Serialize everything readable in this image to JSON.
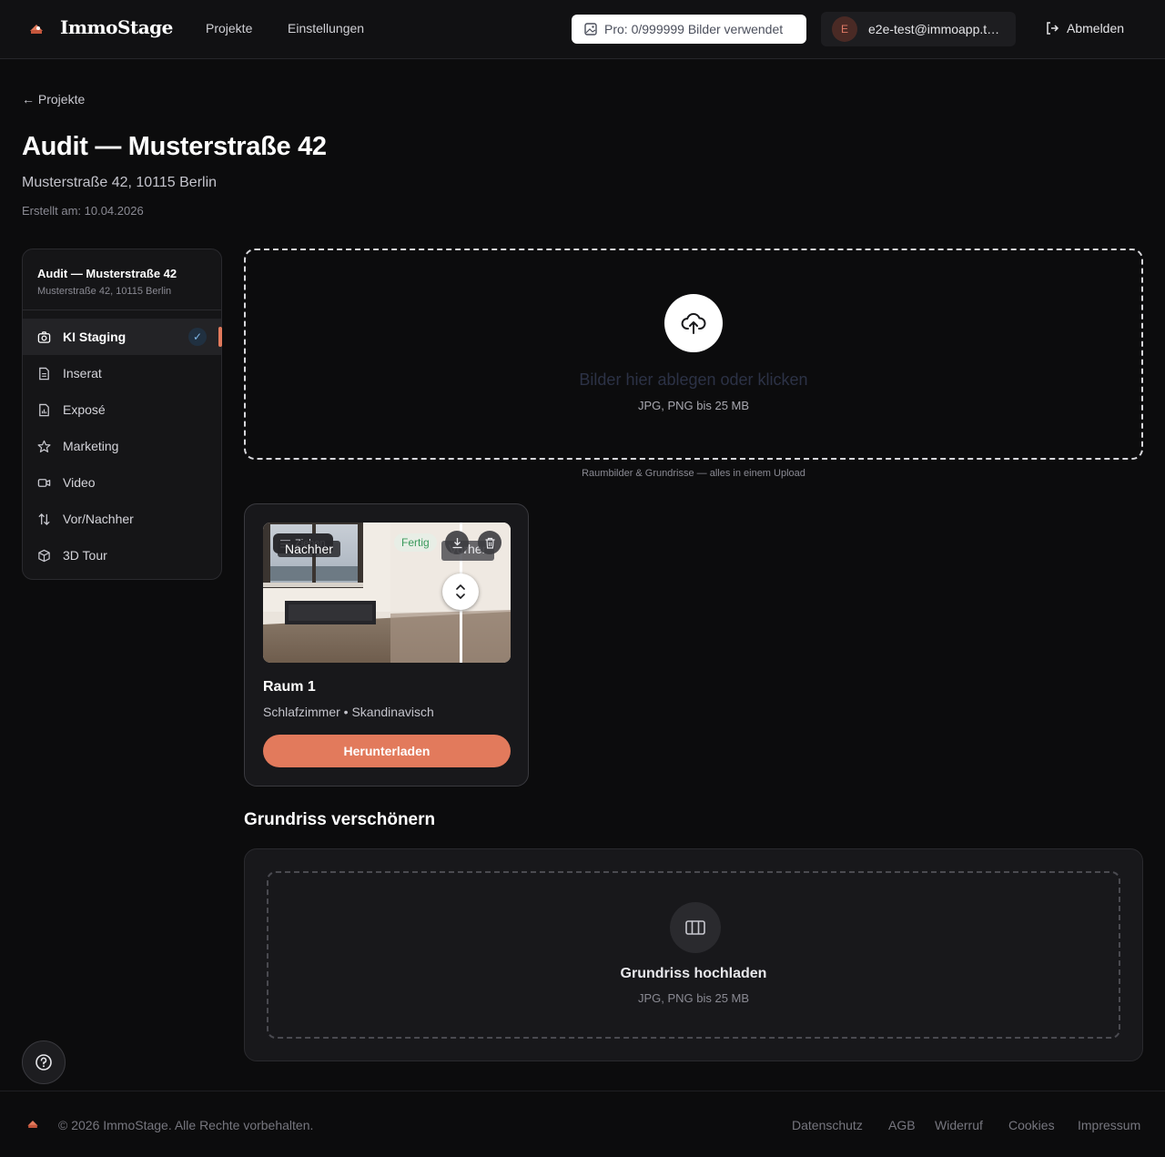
{
  "header": {
    "brand": "ImmoStage",
    "nav": [
      "Projekte",
      "Einstellungen"
    ],
    "usage": "Pro: 0/999999 Bilder verwendet",
    "avatar_initial": "E",
    "user_email": "e2e-test@immoapp.t…",
    "logout": "Abmelden",
    "accent_color": "#e27a5c"
  },
  "page": {
    "back_link": "← Projekte",
    "title": "Audit — Musterstraße 42",
    "address": "Musterstraße 42, 10115 Berlin",
    "created": "Erstellt am: 10.04.2026"
  },
  "sidebar": {
    "title": "Audit — Musterstraße 42",
    "subtitle": "Musterstraße 42, 10115 Berlin",
    "items": [
      {
        "label": "KI Staging",
        "icon": "camera-icon",
        "active": true
      },
      {
        "label": "Inserat",
        "icon": "document-icon"
      },
      {
        "label": "Exposé",
        "icon": "file-chart-icon"
      },
      {
        "label": "Marketing",
        "icon": "star-icon"
      },
      {
        "label": "Video",
        "icon": "video-icon"
      },
      {
        "label": "Vor/Nachher",
        "icon": "arrows-up-down-icon"
      },
      {
        "label": "3D Tour",
        "icon": "cube-icon"
      }
    ]
  },
  "upload": {
    "title": "Bilder hier ablegen oder klicken",
    "subtitle": "JPG, PNG bis 25 MB",
    "hint": "Raumbilder & Grundrisse — alles in einem Upload"
  },
  "room_card": {
    "drag_label": "Ziehen",
    "after_label": "Nachher",
    "before_label": "Vorher",
    "status": "Fertig",
    "name": "Raum 1",
    "meta": "Schlafzimmer • Skandinavisch",
    "download": "Herunterladen"
  },
  "floorplan": {
    "section_title": "Grundriss verschönern",
    "title": "Grundriss hochladen",
    "subtitle": "JPG, PNG bis 25 MB"
  },
  "footer": {
    "copyright": "© 2026 ImmoStage. Alle Rechte vorbehalten.",
    "links": [
      "Datenschutz",
      "AGB",
      "Widerruf",
      "Cookies",
      "Impressum"
    ]
  }
}
